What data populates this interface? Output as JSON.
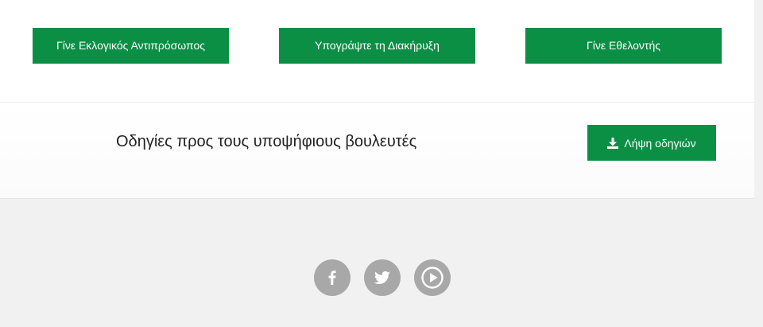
{
  "cta": {
    "representative_label": "Γίνε Εκλογικός Αντιπρόσωπος",
    "declaration_label": "Υπογράψτε τη Διακήρυξη",
    "volunteer_label": "Γίνε Εθελοντής"
  },
  "guide": {
    "text": "Οδηγίες προς τους υποψήφιους βουλευτές",
    "download_label": "Λήψη οδηγιών",
    "download_icon": "download-icon"
  },
  "footer": {
    "social_icons": [
      "facebook-icon",
      "twitter-icon",
      "youtube-play-icon"
    ]
  },
  "colors": {
    "accent_green": "#0a8f44",
    "page_background": "#f1f1f1",
    "social_gray": "#a8a8a8"
  }
}
